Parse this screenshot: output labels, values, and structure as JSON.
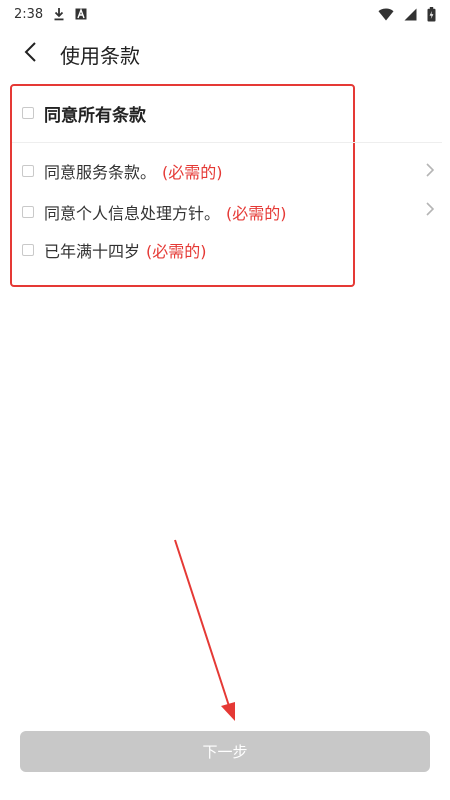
{
  "status_bar": {
    "time": "2:38"
  },
  "header": {
    "title": "使用条款"
  },
  "terms": {
    "all": {
      "label": "同意所有条款"
    },
    "items": [
      {
        "label": "同意服务条款。",
        "required": "(必需的)",
        "has_chevron": true
      },
      {
        "label": "同意个人信息处理方针。",
        "required": "(必需的)",
        "has_chevron": true
      },
      {
        "label": "已年满十四岁",
        "required": "(必需的)",
        "has_chevron": false
      }
    ]
  },
  "footer": {
    "next_label": "下一步"
  },
  "colors": {
    "highlight": "#e53935",
    "required_text": "#e53935",
    "button_disabled": "#c8c8c8"
  },
  "icons": {
    "back": "chevron-left-icon",
    "download": "download-icon",
    "font": "font-a-icon",
    "wifi": "wifi-icon",
    "signal": "signal-icon",
    "battery": "battery-icon"
  }
}
